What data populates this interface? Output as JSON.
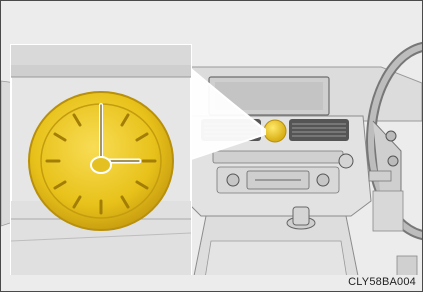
{
  "figure": {
    "code": "CLY58BA004"
  },
  "icons": {
    "clock": "analog-clock-icon",
    "dashboard": "car-dashboard-illustration"
  },
  "colors": {
    "clock_gold": "#e8c21a",
    "clock_rim": "#c9a30f",
    "background": "#e9e9e9"
  }
}
